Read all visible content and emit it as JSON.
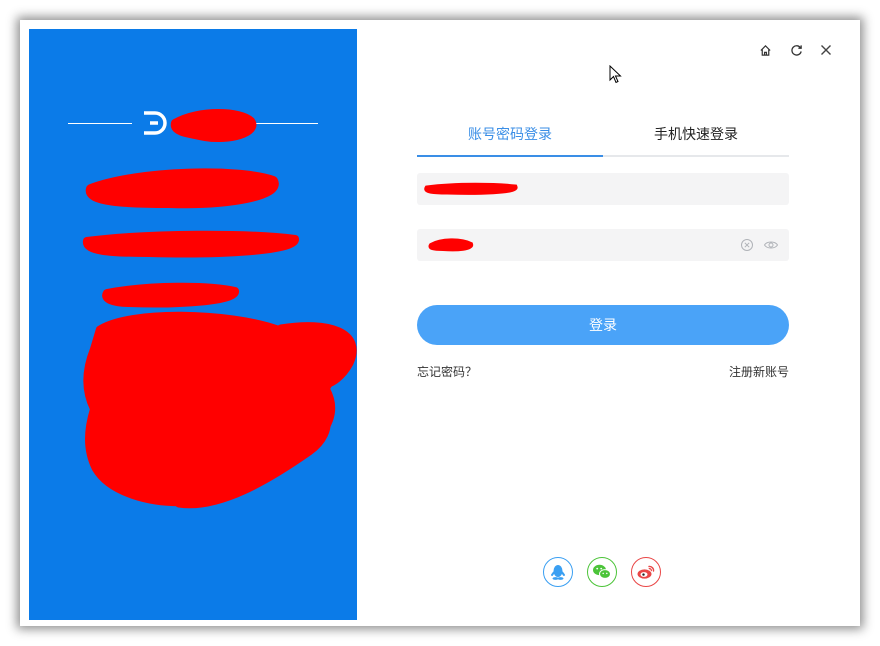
{
  "tabs": [
    {
      "label": "账号密码登录",
      "active": true
    },
    {
      "label": "手机快速登录",
      "active": false
    }
  ],
  "form": {
    "username_value": "",
    "password_value": "",
    "login_label": "登录"
  },
  "links": {
    "forgot_label": "忘记密码？",
    "register_label": "注册新账号"
  },
  "colors": {
    "brand_panel": "#0b7be8",
    "accent": "#3a8ee6",
    "login_button": "#4aa3f8",
    "qq": "#3a9ff2",
    "wechat": "#4cc439",
    "weibo": "#e94646"
  },
  "icons": {
    "window_controls": [
      "home-icon",
      "refresh-icon",
      "close-icon"
    ],
    "password_field": [
      "clear-icon",
      "eye-icon"
    ],
    "social": [
      "qq-icon",
      "wechat-icon",
      "weibo-icon"
    ]
  }
}
